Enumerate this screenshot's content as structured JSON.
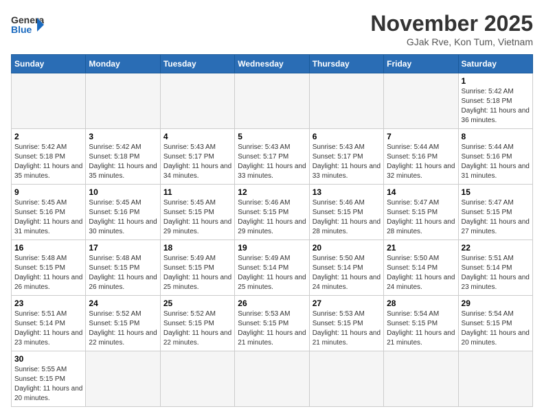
{
  "header": {
    "logo_general": "General",
    "logo_blue": "Blue",
    "month": "November 2025",
    "location": "GJak Rve, Kon Tum, Vietnam"
  },
  "weekdays": [
    "Sunday",
    "Monday",
    "Tuesday",
    "Wednesday",
    "Thursday",
    "Friday",
    "Saturday"
  ],
  "weeks": [
    [
      {
        "day": "",
        "empty": true
      },
      {
        "day": "",
        "empty": true
      },
      {
        "day": "",
        "empty": true
      },
      {
        "day": "",
        "empty": true
      },
      {
        "day": "",
        "empty": true
      },
      {
        "day": "",
        "empty": true
      },
      {
        "day": "1",
        "sunrise": "5:42 AM",
        "sunset": "5:18 PM",
        "daylight": "11 hours and 36 minutes."
      }
    ],
    [
      {
        "day": "2",
        "sunrise": "5:42 AM",
        "sunset": "5:18 PM",
        "daylight": "11 hours and 35 minutes."
      },
      {
        "day": "3",
        "sunrise": "5:42 AM",
        "sunset": "5:18 PM",
        "daylight": "11 hours and 35 minutes."
      },
      {
        "day": "4",
        "sunrise": "5:43 AM",
        "sunset": "5:17 PM",
        "daylight": "11 hours and 34 minutes."
      },
      {
        "day": "5",
        "sunrise": "5:43 AM",
        "sunset": "5:17 PM",
        "daylight": "11 hours and 33 minutes."
      },
      {
        "day": "6",
        "sunrise": "5:43 AM",
        "sunset": "5:17 PM",
        "daylight": "11 hours and 33 minutes."
      },
      {
        "day": "7",
        "sunrise": "5:44 AM",
        "sunset": "5:16 PM",
        "daylight": "11 hours and 32 minutes."
      },
      {
        "day": "8",
        "sunrise": "5:44 AM",
        "sunset": "5:16 PM",
        "daylight": "11 hours and 31 minutes."
      }
    ],
    [
      {
        "day": "9",
        "sunrise": "5:45 AM",
        "sunset": "5:16 PM",
        "daylight": "11 hours and 31 minutes."
      },
      {
        "day": "10",
        "sunrise": "5:45 AM",
        "sunset": "5:16 PM",
        "daylight": "11 hours and 30 minutes."
      },
      {
        "day": "11",
        "sunrise": "5:45 AM",
        "sunset": "5:15 PM",
        "daylight": "11 hours and 29 minutes."
      },
      {
        "day": "12",
        "sunrise": "5:46 AM",
        "sunset": "5:15 PM",
        "daylight": "11 hours and 29 minutes."
      },
      {
        "day": "13",
        "sunrise": "5:46 AM",
        "sunset": "5:15 PM",
        "daylight": "11 hours and 28 minutes."
      },
      {
        "day": "14",
        "sunrise": "5:47 AM",
        "sunset": "5:15 PM",
        "daylight": "11 hours and 28 minutes."
      },
      {
        "day": "15",
        "sunrise": "5:47 AM",
        "sunset": "5:15 PM",
        "daylight": "11 hours and 27 minutes."
      }
    ],
    [
      {
        "day": "16",
        "sunrise": "5:48 AM",
        "sunset": "5:15 PM",
        "daylight": "11 hours and 26 minutes."
      },
      {
        "day": "17",
        "sunrise": "5:48 AM",
        "sunset": "5:15 PM",
        "daylight": "11 hours and 26 minutes."
      },
      {
        "day": "18",
        "sunrise": "5:49 AM",
        "sunset": "5:15 PM",
        "daylight": "11 hours and 25 minutes."
      },
      {
        "day": "19",
        "sunrise": "5:49 AM",
        "sunset": "5:14 PM",
        "daylight": "11 hours and 25 minutes."
      },
      {
        "day": "20",
        "sunrise": "5:50 AM",
        "sunset": "5:14 PM",
        "daylight": "11 hours and 24 minutes."
      },
      {
        "day": "21",
        "sunrise": "5:50 AM",
        "sunset": "5:14 PM",
        "daylight": "11 hours and 24 minutes."
      },
      {
        "day": "22",
        "sunrise": "5:51 AM",
        "sunset": "5:14 PM",
        "daylight": "11 hours and 23 minutes."
      }
    ],
    [
      {
        "day": "23",
        "sunrise": "5:51 AM",
        "sunset": "5:14 PM",
        "daylight": "11 hours and 23 minutes."
      },
      {
        "day": "24",
        "sunrise": "5:52 AM",
        "sunset": "5:15 PM",
        "daylight": "11 hours and 22 minutes."
      },
      {
        "day": "25",
        "sunrise": "5:52 AM",
        "sunset": "5:15 PM",
        "daylight": "11 hours and 22 minutes."
      },
      {
        "day": "26",
        "sunrise": "5:53 AM",
        "sunset": "5:15 PM",
        "daylight": "11 hours and 21 minutes."
      },
      {
        "day": "27",
        "sunrise": "5:53 AM",
        "sunset": "5:15 PM",
        "daylight": "11 hours and 21 minutes."
      },
      {
        "day": "28",
        "sunrise": "5:54 AM",
        "sunset": "5:15 PM",
        "daylight": "11 hours and 21 minutes."
      },
      {
        "day": "29",
        "sunrise": "5:54 AM",
        "sunset": "5:15 PM",
        "daylight": "11 hours and 20 minutes."
      }
    ],
    [
      {
        "day": "30",
        "sunrise": "5:55 AM",
        "sunset": "5:15 PM",
        "daylight": "11 hours and 20 minutes."
      },
      {
        "day": "",
        "empty": true
      },
      {
        "day": "",
        "empty": true
      },
      {
        "day": "",
        "empty": true
      },
      {
        "day": "",
        "empty": true
      },
      {
        "day": "",
        "empty": true
      },
      {
        "day": "",
        "empty": true
      }
    ]
  ]
}
